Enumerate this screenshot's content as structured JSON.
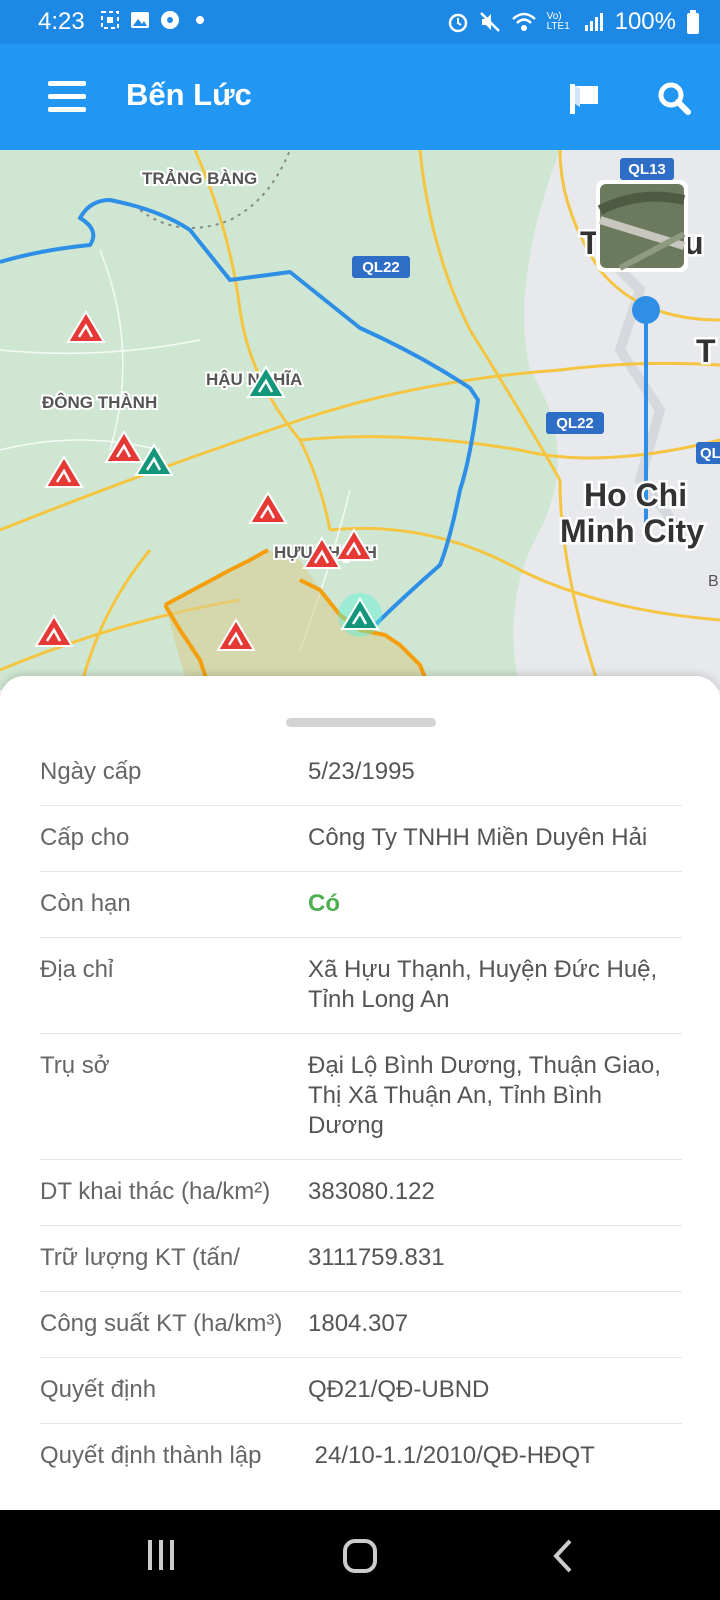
{
  "status_bar": {
    "time": "4:23",
    "battery": "100%",
    "network": "Vo) LTE1"
  },
  "app_bar": {
    "title": "Bến Lức",
    "left_icon": "menu-icon",
    "right_icons": [
      "flag-icon",
      "search-icon"
    ]
  },
  "map": {
    "labels": {
      "trang_bang": "TRẢNG BÀNG",
      "hau_nghia": "HẬU NGHĨA",
      "dong_thanh": "ĐÔNG THÀNH",
      "huu_thanh": "HỰU THẠNH",
      "city_line1": "Ho Chi",
      "city_line2": "Minh City",
      "ql13": "QL13",
      "ql22_a": "QL22",
      "ql22_b": "QL22",
      "ql_edge": "QL",
      "edge_t": "T",
      "edge_u": "u",
      "edge_b": "B"
    },
    "marker_icons": [
      "mining-site-red-icon",
      "mining-site-green-icon"
    ],
    "colors": {
      "map_green": "#cfe7d2",
      "road_yellow": "#f5c542",
      "river_blue": "#2196f3",
      "boundary_orange": "#f59e0b",
      "marker_red": "#e53935",
      "marker_green": "#14967a"
    }
  },
  "details": {
    "rows": [
      {
        "label": "Ngày cấp",
        "value": "5/23/1995"
      },
      {
        "label": "Cấp cho",
        "value": "Công Ty TNHH Miền Duyên Hải"
      },
      {
        "label": "Còn hạn",
        "value": "Có"
      },
      {
        "label": "Địa chỉ",
        "value": "Xã Hựu Thạnh, Huyện Đức Huệ, Tỉnh Long An"
      },
      {
        "label": "Trụ sở",
        "value": "Đại Lộ Bình Dương, Thuận Giao, Thị Xã Thuận An, Tỉnh Bình Dương"
      },
      {
        "label": "DT khai thác (ha/km²)",
        "value": "383080.122"
      },
      {
        "label": "Trữ lượng KT (tấn/",
        "value": "3111759.831"
      },
      {
        "label": "Công suất KT (ha/km³)",
        "value": "1804.307"
      },
      {
        "label": "Quyết định",
        "value": "QĐ21/QĐ-UBND"
      },
      {
        "label": "Quyết định thành lập",
        "value": " 24/10-1.1/2010/QĐ-HĐQT"
      }
    ],
    "highlight_color": "#4caf50"
  },
  "nav_bar": {
    "buttons": [
      "recent-apps-icon",
      "home-icon",
      "back-icon"
    ]
  }
}
